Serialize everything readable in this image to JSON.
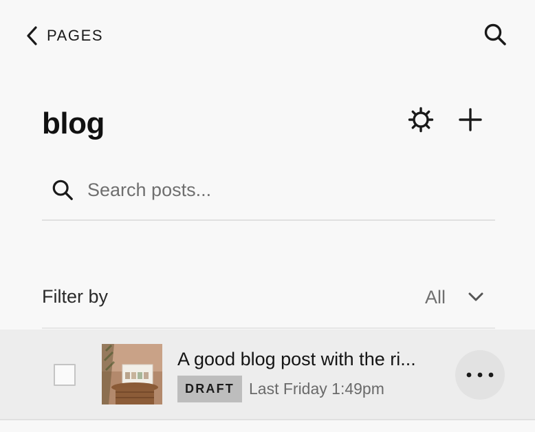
{
  "nav": {
    "back_label": "PAGES",
    "back_icon": "chevron-left-icon",
    "search_icon": "search-icon"
  },
  "header": {
    "title": "blog",
    "settings_icon": "gear-icon",
    "add_icon": "plus-icon"
  },
  "search": {
    "placeholder": "Search posts...",
    "value": ""
  },
  "filter": {
    "label": "Filter by",
    "selected": "All",
    "dropdown_icon": "chevron-down-icon"
  },
  "posts": [
    {
      "title": "A good blog post with the ri...",
      "status": "DRAFT",
      "date": "Last Friday 1:49pm",
      "checked": false,
      "more_icon": "more-horizontal-icon"
    }
  ],
  "colors": {
    "background": "#f8f8f8",
    "row_background": "#ededed",
    "badge_background": "#bdbdbd",
    "text_primary": "#1a1a1a",
    "text_muted": "#6f6f6f"
  }
}
